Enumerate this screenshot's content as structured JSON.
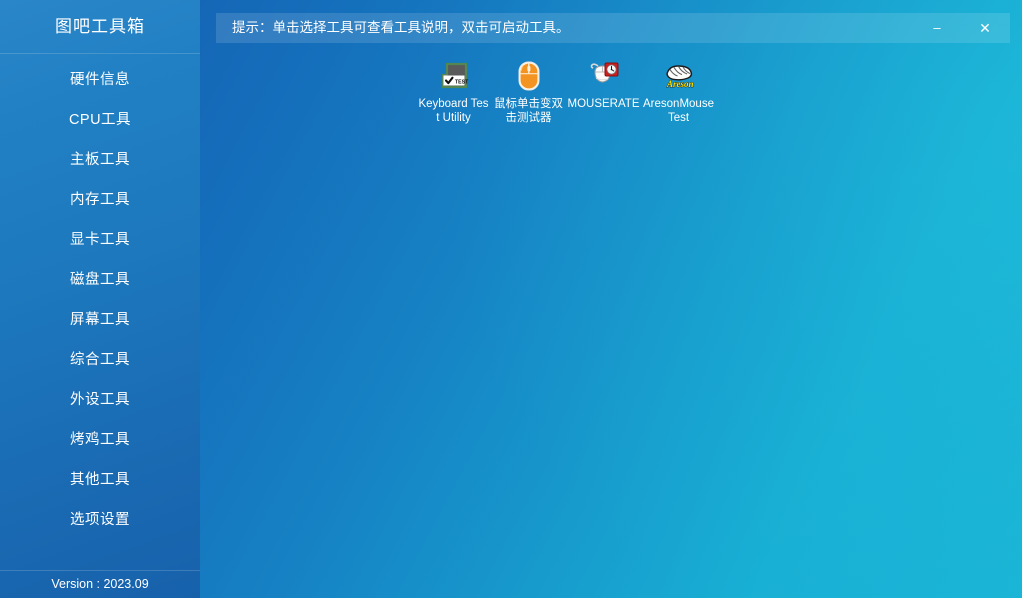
{
  "sidebar": {
    "title": "图吧工具箱",
    "items": [
      {
        "label": "硬件信息",
        "name": "hardware-info"
      },
      {
        "label": "CPU工具",
        "name": "cpu-tools"
      },
      {
        "label": "主板工具",
        "name": "motherboard-tools"
      },
      {
        "label": "内存工具",
        "name": "memory-tools"
      },
      {
        "label": "显卡工具",
        "name": "gpu-tools"
      },
      {
        "label": "磁盘工具",
        "name": "disk-tools"
      },
      {
        "label": "屏幕工具",
        "name": "screen-tools"
      },
      {
        "label": "综合工具",
        "name": "general-tools"
      },
      {
        "label": "外设工具",
        "name": "peripheral-tools"
      },
      {
        "label": "烤鸡工具",
        "name": "stress-test-tools"
      },
      {
        "label": "其他工具",
        "name": "other-tools"
      },
      {
        "label": "选项设置",
        "name": "settings"
      }
    ],
    "version": "Version : 2023.09"
  },
  "titlebar": {
    "hint": "提示：单击选择工具可查看工具说明，双击可启动工具。",
    "minimize_label": "–",
    "close_label": "✕"
  },
  "tools": [
    {
      "label": "Keyboard Test Utility",
      "icon": "keyboard-test-icon"
    },
    {
      "label": "鼠标单击变双击测试器",
      "icon": "orange-mouse-icon"
    },
    {
      "label": "MOUSERATE",
      "icon": "mouse-rate-clock-icon"
    },
    {
      "label": "AresonMouseTest",
      "icon": "areson-mouse-icon"
    }
  ],
  "colors": {
    "sidebar_top": "#2a86c8",
    "sidebar_bottom": "#1761ab",
    "main_left": "#1567b6",
    "main_right": "#1ab4d6",
    "hint_bg": "rgba(255,255,255,0.13)",
    "text": "#ffffff",
    "icon_green": "#3f8f3f",
    "icon_gray": "#5a5a5a",
    "icon_orange": "#f39422",
    "icon_red": "#cc2020",
    "icon_yellow": "#ffe800"
  }
}
